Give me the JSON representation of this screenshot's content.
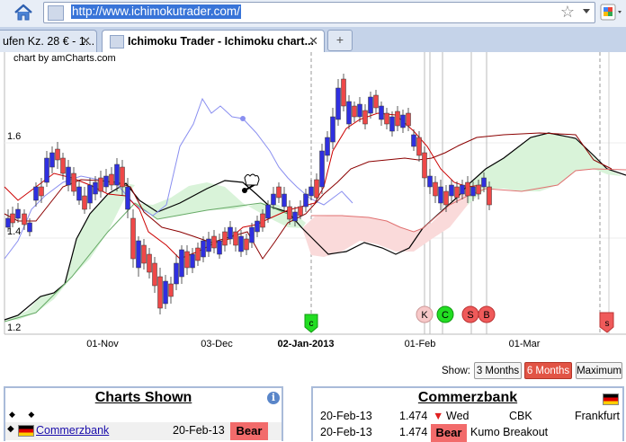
{
  "browser": {
    "url": "http://www.ichimokutrader.com/",
    "tabs": [
      {
        "label": "ufen Kz. 28 € - 1...",
        "close": "✕"
      },
      {
        "label": "Ichimoku Trader - Ichimoku chart...",
        "close": "✕"
      }
    ],
    "new_tab": "+"
  },
  "chart": {
    "credit": "chart by amCharts.com",
    "y_ticks": [
      {
        "label": "1.6"
      },
      {
        "label": "1.4"
      },
      {
        "label": "1.2"
      }
    ],
    "x_ticks": [
      {
        "label": "01-Nov",
        "bold": false
      },
      {
        "label": "03-Dec",
        "bold": false
      },
      {
        "label": "02-Jan-2013",
        "bold": true
      },
      {
        "label": "01-Feb",
        "bold": false
      },
      {
        "label": "01-Mar",
        "bold": false
      }
    ],
    "signal_markers": [
      {
        "label": "c",
        "color": "#22dd22",
        "shape": "flag"
      },
      {
        "label": "K",
        "color": "#f7c8c8",
        "shape": "circle"
      },
      {
        "label": "C",
        "color": "#22dd22",
        "shape": "circle"
      },
      {
        "label": "S",
        "color": "#ef5a5a",
        "shape": "circle"
      },
      {
        "label": "B",
        "color": "#ef5a5a",
        "shape": "circle"
      },
      {
        "label": "s",
        "color": "#ef5a5a",
        "shape": "flag"
      }
    ],
    "colors": {
      "bull_candle": "#2f2fe0",
      "bear_candle": "#ef4848",
      "kumo_bull_fill": "#d9f3d9",
      "kumo_bear_fill": "#fadada",
      "tenkan": "#cc0000",
      "kijun": "#8b0000",
      "chikou": "#8a8ff0",
      "senkou_a": "#000000"
    }
  },
  "controls": {
    "show_label": "Show:",
    "ranges": [
      {
        "label": "3 Months",
        "selected": false
      },
      {
        "label": "6 Months",
        "selected": true
      },
      {
        "label": "Maximum",
        "selected": false
      }
    ]
  },
  "charts_shown": {
    "title": "Charts Shown",
    "info_icon": "i",
    "bullets": "◆ ◆",
    "row": {
      "name": "Commerzbank",
      "date": "20-Feb-13",
      "signal": "Bear"
    }
  },
  "stock_panel": {
    "title": "Commerzbank",
    "rows": [
      {
        "date": "20-Feb-13",
        "price": "1.474",
        "arrow": "▼",
        "day": "Wed",
        "symbol": "CBK",
        "exchange": "Frankfurt"
      },
      {
        "date": "20-Feb-13",
        "price": "1.474",
        "signal": "Bear",
        "event": "Kumo Breakout"
      }
    ]
  }
}
